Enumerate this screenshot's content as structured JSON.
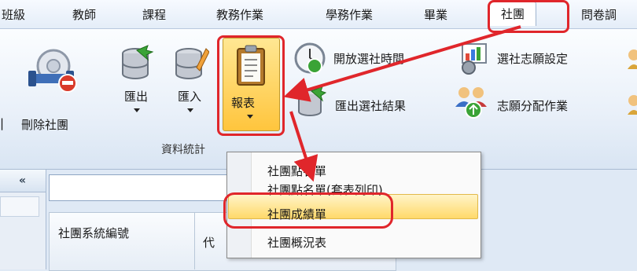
{
  "menubar": {
    "items": [
      {
        "label": "班級"
      },
      {
        "label": "教師"
      },
      {
        "label": "課程"
      },
      {
        "label": "教務作業"
      },
      {
        "label": "學務作業"
      },
      {
        "label": "畢業"
      },
      {
        "label": "社團"
      },
      {
        "label": "問卷調"
      }
    ],
    "active": "社團"
  },
  "ribbon": {
    "delete_club": "刪除社團",
    "export": "匯出",
    "import": "匯入",
    "report": "報表",
    "open_selection_time": "開放選社時間",
    "export_selection_result": "匯出選社結果",
    "preference_setting": "選社志願設定",
    "preference_assignment": "志願分配作業",
    "group_data_stats": "資料統計"
  },
  "left_panel": {
    "collapse_glyph": "«"
  },
  "grid": {
    "columns": [
      {
        "label": "社團系統編號"
      },
      {
        "label": "代"
      }
    ]
  },
  "report_menu": {
    "items": [
      {
        "label": "社團點名單"
      },
      {
        "label": "社團點名單(套表列印)"
      },
      {
        "label": "社團成績單"
      },
      {
        "label": "社團概況表"
      }
    ],
    "highlighted": "社團成績單"
  },
  "colors": {
    "highlight_border": "#e0262b",
    "ribbon_bg": "#e9f0f9",
    "report_button": "#ffc53d"
  }
}
